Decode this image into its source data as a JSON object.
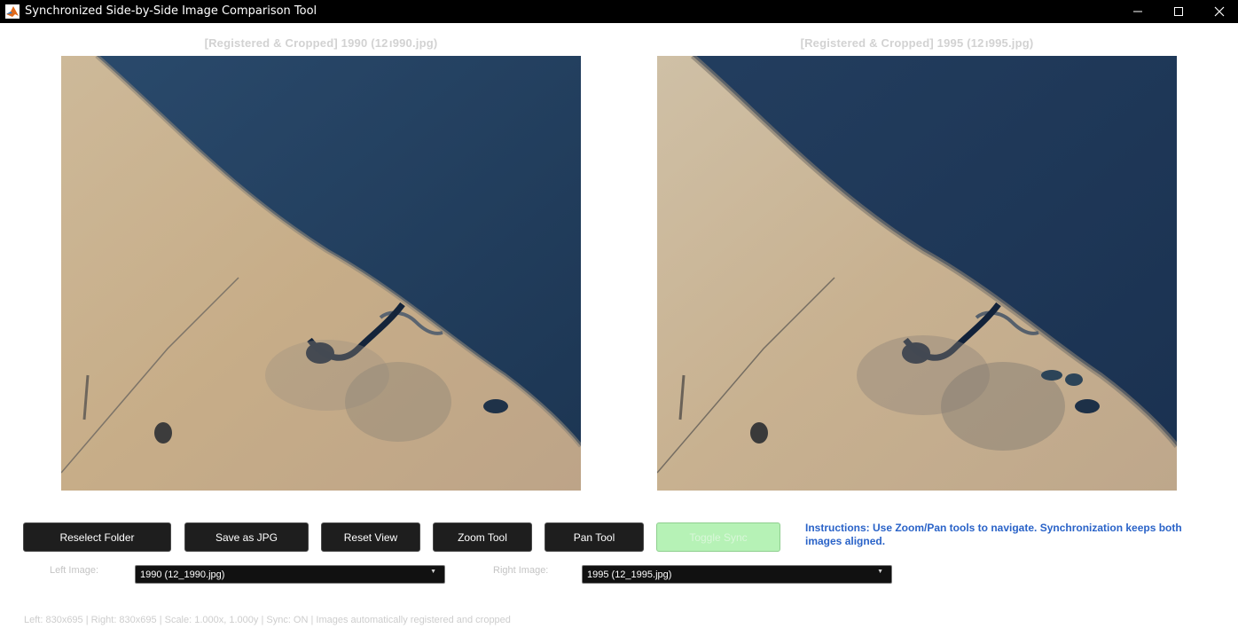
{
  "window": {
    "title": "Synchronized Side-by-Side Image Comparison Tool",
    "controls": [
      "minimize-icon",
      "maximize-icon",
      "close-icon"
    ]
  },
  "left_panel": {
    "title": "[Registered  &  Cropped]  1990  (12 ı990.jpg)",
    "image": "satellite image of coastline, 1990"
  },
  "right_panel": {
    "title": "[Registered  &  Cropped]  1995  (12 ı995.jpg)",
    "image": "satellite image of coastline, 1995"
  },
  "toolbar": {
    "reselect_folder": "Reselect Folder",
    "save_as_jpg": "Save as JPG",
    "reset_view": "Reset View",
    "zoom_tool": "Zoom Tool",
    "pan_tool": "Pan Tool",
    "toggle_sync": "Toggle Sync"
  },
  "instructions": "Instructions: Use Zoom/Pan tools to navigate. Synchronization keeps both images aligned.",
  "selectors": {
    "left_label": "Left Image:",
    "left_value": "1990 (12_1990.jpg)",
    "right_label": "Right Image:",
    "right_value": "1995 (12_1995.jpg)"
  },
  "status": "Left: 830x695  |  Right: 830x695  |  Scale: 1.000x, 1.000y  |  Sync: ON  |  Images automatically registered and cropped",
  "colors": {
    "titlebar": "#000000",
    "button_bg": "#1e1e1e",
    "sync_button_bg": "#b6f2b6",
    "instructions_text": "#2a63c8",
    "sea": "#1f3a5a",
    "land": "#c9b392"
  }
}
